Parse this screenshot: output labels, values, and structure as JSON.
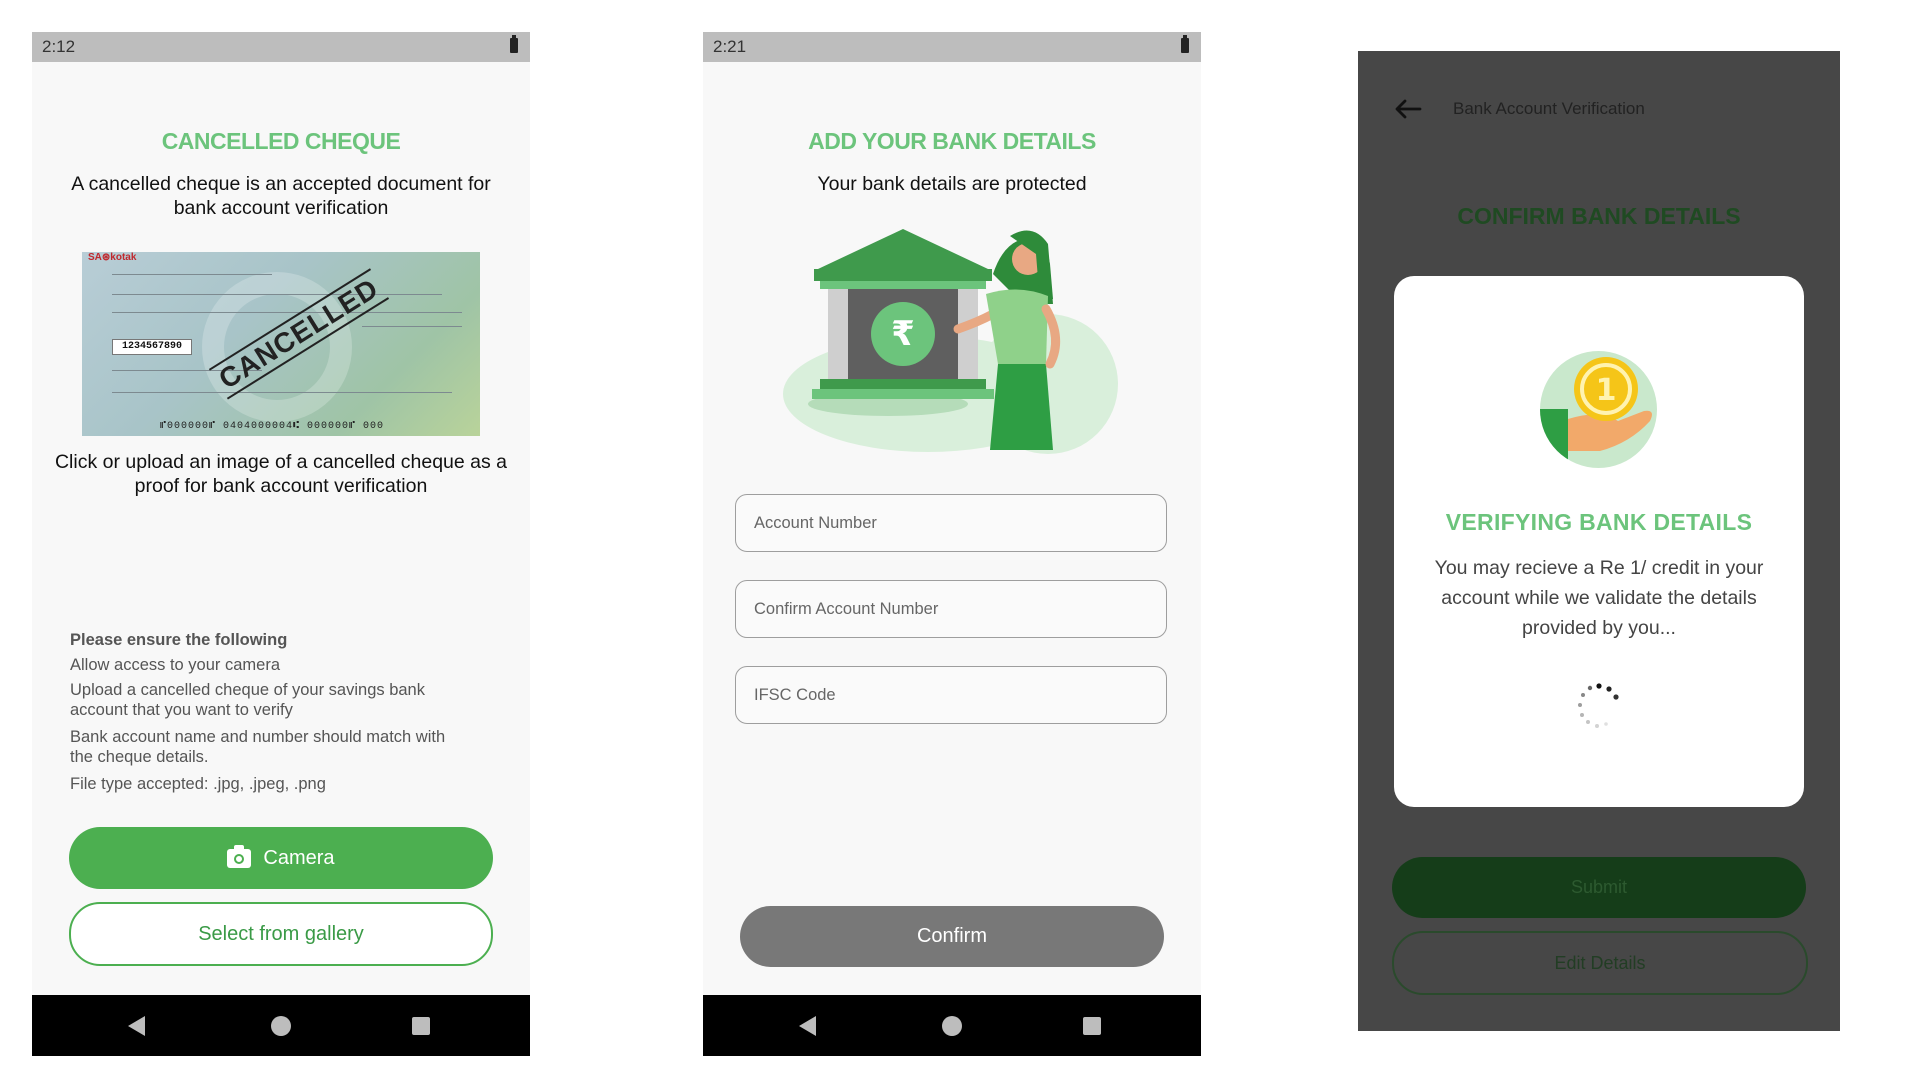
{
  "screen1": {
    "status_time": "2:12",
    "title": "CANCELLED CHEQUE",
    "subtitle": "A cancelled cheque is an accepted document for bank account verification",
    "cheque_image": {
      "account_number": "1234567890",
      "stamp": "CANCELLED",
      "micr": "⑈000000⑈ 0404000004⑆ 000000⑈ 000"
    },
    "upload_text": "Click or upload an image of a cancelled cheque as a proof for bank account verification",
    "instructions_heading": "Please ensure the following",
    "instructions": [
      "Allow access to your camera",
      "Upload a cancelled cheque of your savings bank account that you want to verify",
      "Bank account name and number should match with the cheque details.",
      "File type accepted: .jpg, .jpeg, .png"
    ],
    "camera_label": "Camera",
    "gallery_label": "Select from gallery"
  },
  "screen2": {
    "status_time": "2:21",
    "title": "ADD YOUR BANK DETAILS",
    "subtitle": "Your bank details are protected",
    "fields": {
      "account_number_placeholder": "Account Number",
      "confirm_account_number_placeholder": "Confirm Account Number",
      "ifsc_placeholder": "IFSC Code"
    },
    "confirm_label": "Confirm",
    "rupee_symbol": "₹"
  },
  "screen3": {
    "header_title": "Bank Account Verification",
    "heading": "CONFIRM BANK DETAILS",
    "modal_title": "VERIFYING BANK DETAILS",
    "modal_text": "You may recieve a Re 1/ credit in your account while we validate the details provided by you...",
    "coin_value": "1",
    "submit_label": "Submit",
    "edit_label": "Edit Details"
  },
  "colors": {
    "accent_green": "#4caf50",
    "title_green": "#6cc47c",
    "overlay_dark": "#474747"
  }
}
